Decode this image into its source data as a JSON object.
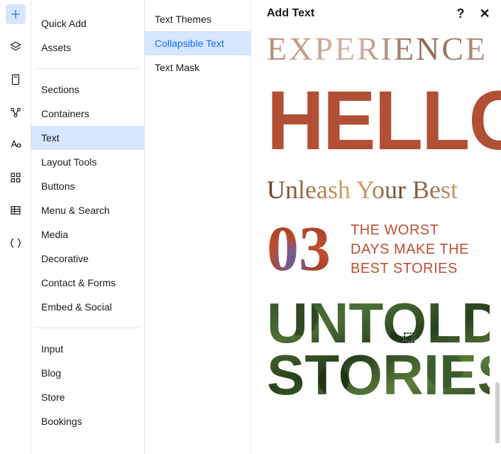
{
  "panel": {
    "title": "Add Text"
  },
  "rail": [
    {
      "name": "plus-icon",
      "active": true
    },
    {
      "name": "layers-icon",
      "active": false
    },
    {
      "name": "page-icon",
      "active": false
    },
    {
      "name": "connections-icon",
      "active": false
    },
    {
      "name": "typography-icon",
      "active": false
    },
    {
      "name": "apps-icon",
      "active": false
    },
    {
      "name": "data-icon",
      "active": false
    },
    {
      "name": "code-icon",
      "active": false
    }
  ],
  "categories": {
    "group1": [
      {
        "key": "quick-add",
        "label": "Quick Add"
      },
      {
        "key": "assets",
        "label": "Assets"
      }
    ],
    "group2": [
      {
        "key": "sections",
        "label": "Sections"
      },
      {
        "key": "containers",
        "label": "Containers"
      },
      {
        "key": "text",
        "label": "Text",
        "active": true
      },
      {
        "key": "layout-tools",
        "label": "Layout Tools"
      },
      {
        "key": "buttons",
        "label": "Buttons"
      },
      {
        "key": "menu-search",
        "label": "Menu & Search"
      },
      {
        "key": "media",
        "label": "Media"
      },
      {
        "key": "decorative",
        "label": "Decorative"
      },
      {
        "key": "contact-forms",
        "label": "Contact & Forms"
      },
      {
        "key": "embed-social",
        "label": "Embed & Social"
      }
    ],
    "group3": [
      {
        "key": "input",
        "label": "Input"
      },
      {
        "key": "blog",
        "label": "Blog"
      },
      {
        "key": "store",
        "label": "Store"
      },
      {
        "key": "bookings",
        "label": "Bookings"
      }
    ]
  },
  "subcategories": [
    {
      "key": "text-themes",
      "label": "Text Themes"
    },
    {
      "key": "collapsible-text",
      "label": "Collapsible Text",
      "active": true
    },
    {
      "key": "text-mask",
      "label": "Text Mask"
    }
  ],
  "previews": {
    "experience": "EXPERIENCE",
    "hello": "HELLO",
    "unleash": "Unleash Your Best",
    "ordinal": {
      "num": "03",
      "line1": "THE WORST",
      "line2": "DAYS MAKE THE",
      "line3": "BEST STORIES"
    },
    "untold": {
      "line1": "UNTOLD",
      "line2": "STORIES"
    }
  }
}
